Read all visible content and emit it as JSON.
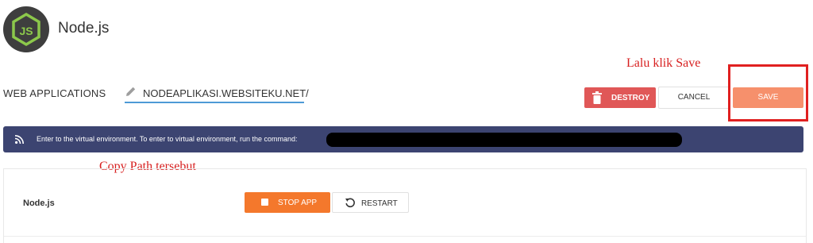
{
  "app": {
    "title": "Node.js",
    "logo_icon": "nodejs-logo-icon"
  },
  "annotations": {
    "save_hint": "Lalu klik Save",
    "copy_hint": "Copy Path tersebut",
    "color": "#d71f1f"
  },
  "web_applications": {
    "label": "WEB APPLICATIONS",
    "path": "NODEAPLIKASI.WEBSITEKU.NET/",
    "edit_icon": "pencil-icon"
  },
  "actions": {
    "destroy_label": "DESTROY",
    "cancel_label": "CANCEL",
    "save_label": "SAVE"
  },
  "info_bar": {
    "icon": "rss-icon",
    "text": "Enter to the virtual environment. To enter to virtual environment, run the command:"
  },
  "panel": {
    "label": "Node.js",
    "stop_label": "STOP APP",
    "restart_label": "RESTART"
  },
  "colors": {
    "destroy": "#e05757",
    "save": "#f6906c",
    "stop": "#f4782c",
    "info_bar": "#3c4471",
    "path_underline": "#4d9ad6"
  }
}
